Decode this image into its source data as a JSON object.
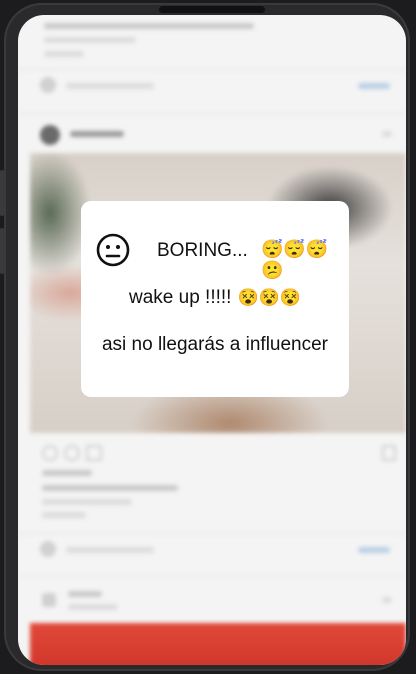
{
  "overlay_card": {
    "boring_label": "BORING...",
    "boring_emojis": "😴😴😴😕",
    "wake_label": "wake up !!!!!",
    "wake_emojis": "😵😵😵",
    "influencer_label": "asi no llegarás a influencer",
    "face_icon": "neutral-face-icon"
  },
  "colors": {
    "card_bg": "#ffffff",
    "phone_frame": "#2a2a2c",
    "feed_bg": "#f4f4f4",
    "banner_red": "#d93a2c"
  }
}
